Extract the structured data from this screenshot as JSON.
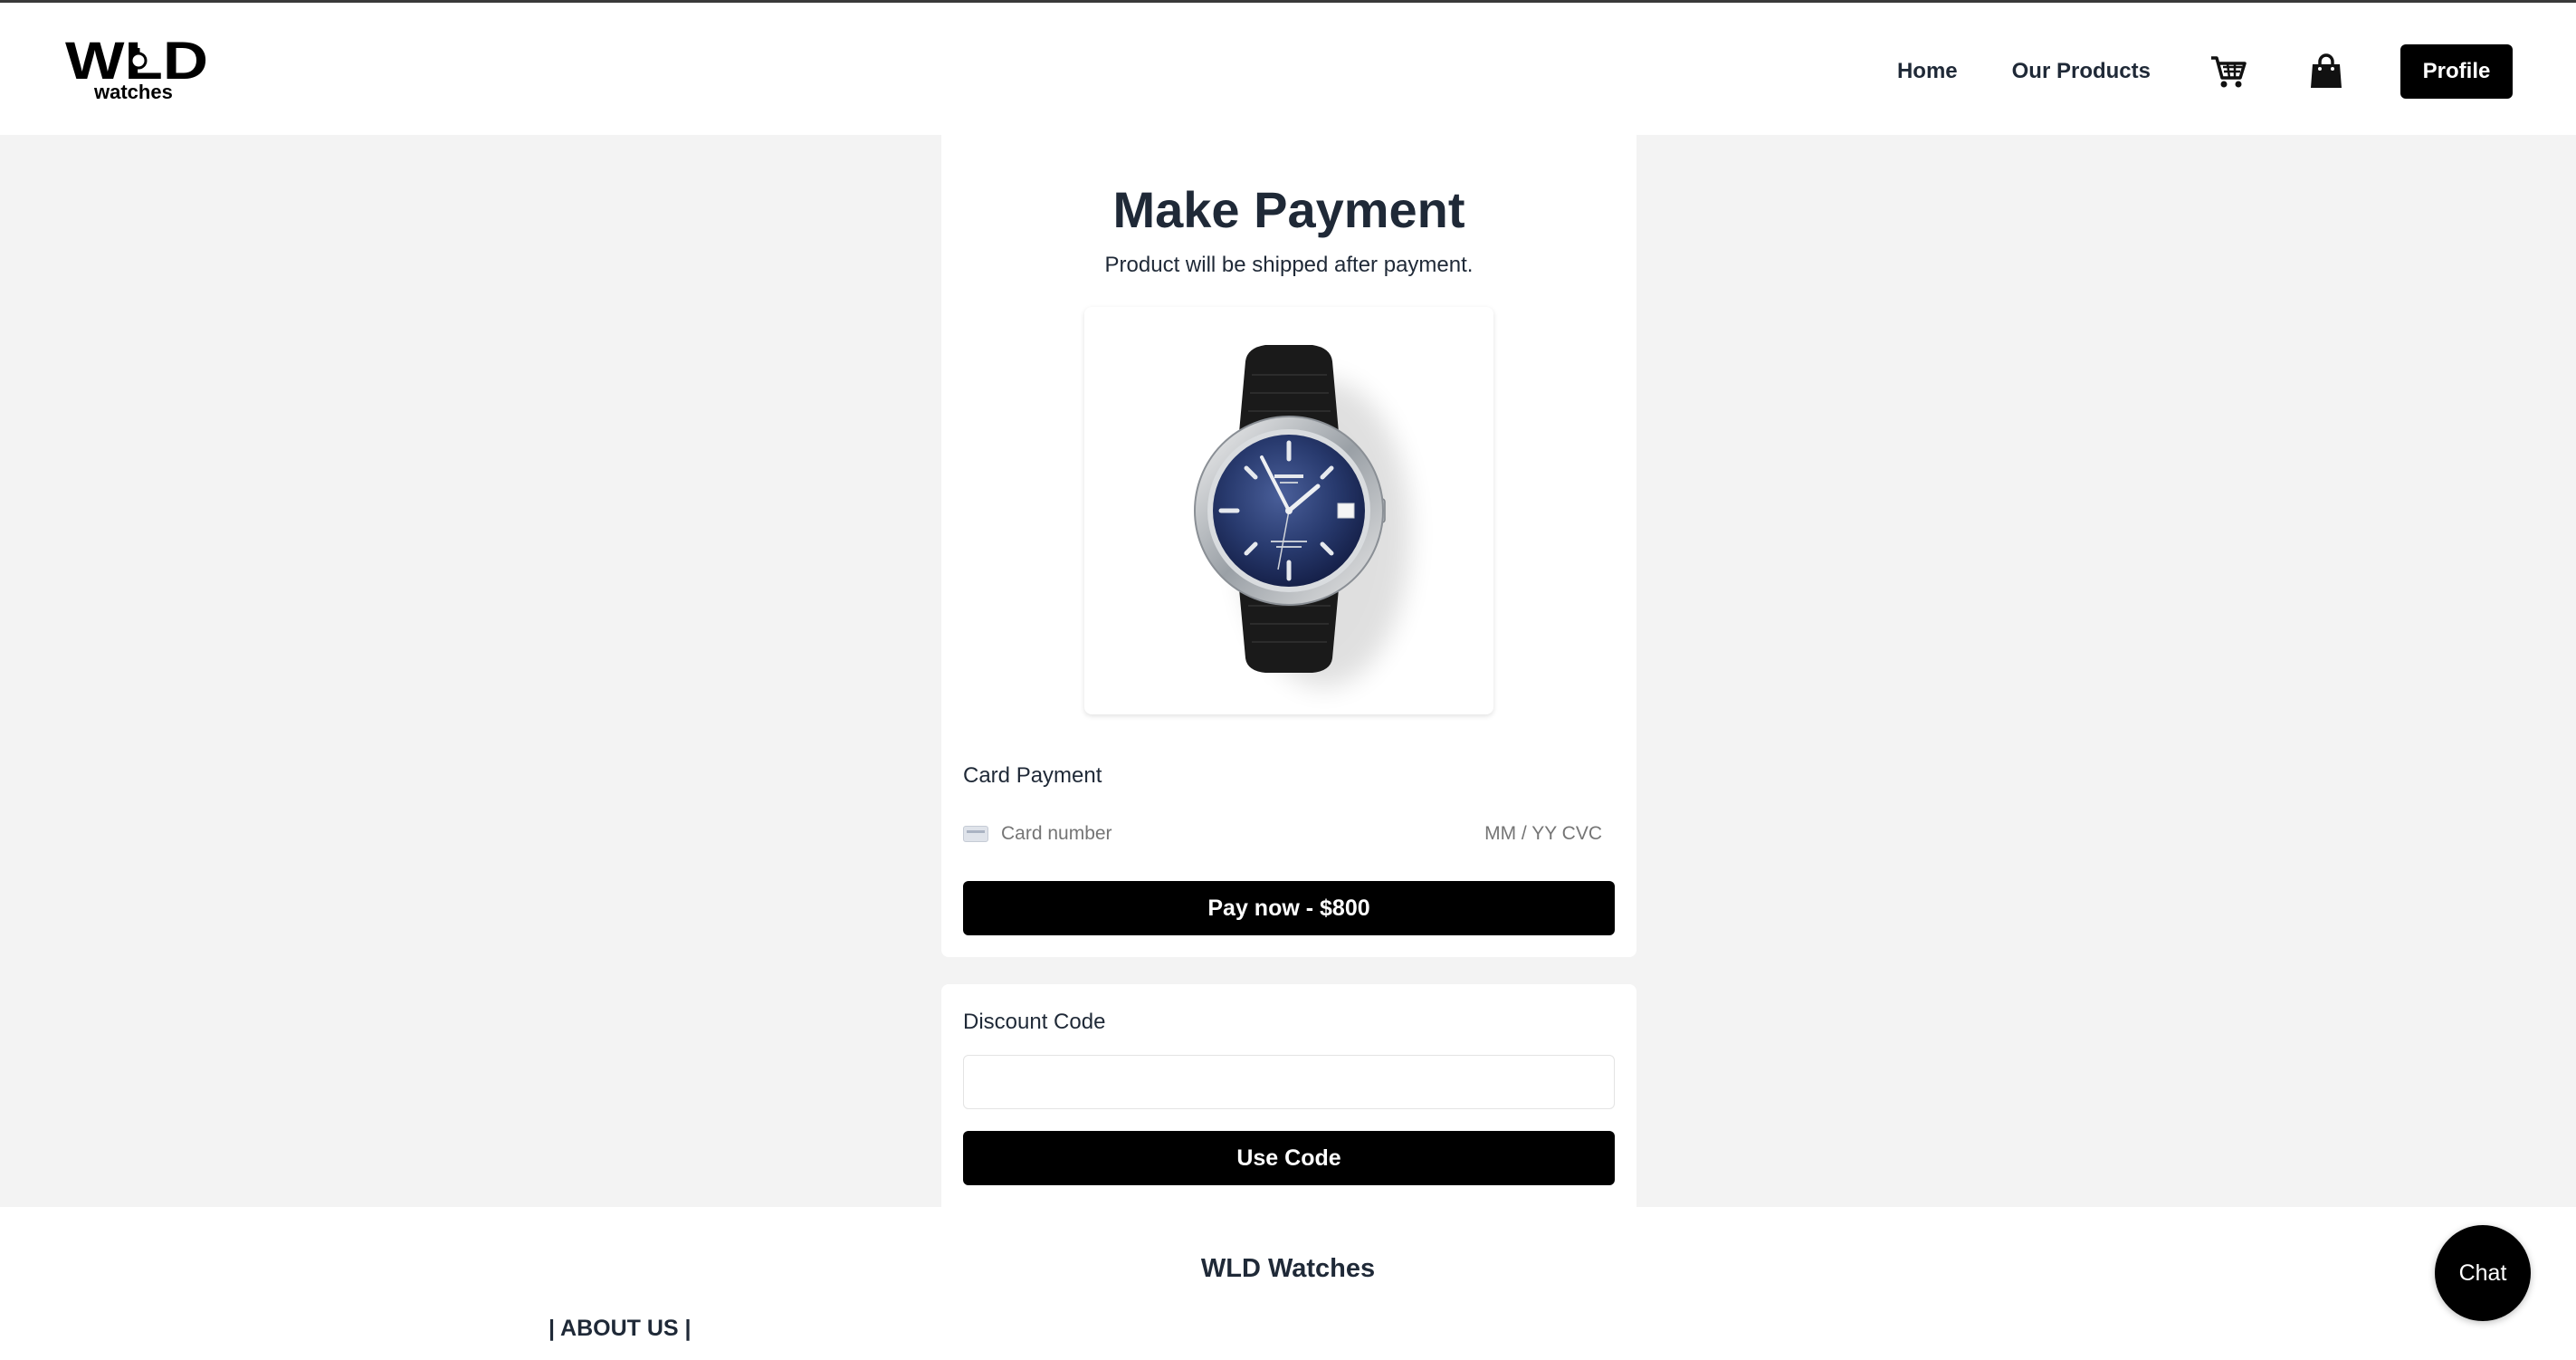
{
  "brand": {
    "logo_text": "WLD",
    "logo_sub": "watches"
  },
  "nav": {
    "home": "Home",
    "products": "Our Products",
    "cart_icon": "shopping-cart-icon",
    "bag_icon": "shopping-bag-icon",
    "profile": "Profile"
  },
  "payment": {
    "title": "Make Payment",
    "subtitle": "Product will be shipped after payment.",
    "product_image": "watch-product-image",
    "card_section_label": "Card Payment",
    "card_number_placeholder": "Card number",
    "expiry_cvc_placeholder": "MM / YY  CVC",
    "pay_button": "Pay now - $800"
  },
  "discount": {
    "label": "Discount Code",
    "input_value": "",
    "button": "Use Code"
  },
  "footer": {
    "title": "WLD Watches",
    "about": "| ABOUT US |"
  },
  "chat": {
    "label": "Chat"
  },
  "colors": {
    "accent": "#000000",
    "background": "#f3f3f3",
    "text": "#1f2937"
  }
}
